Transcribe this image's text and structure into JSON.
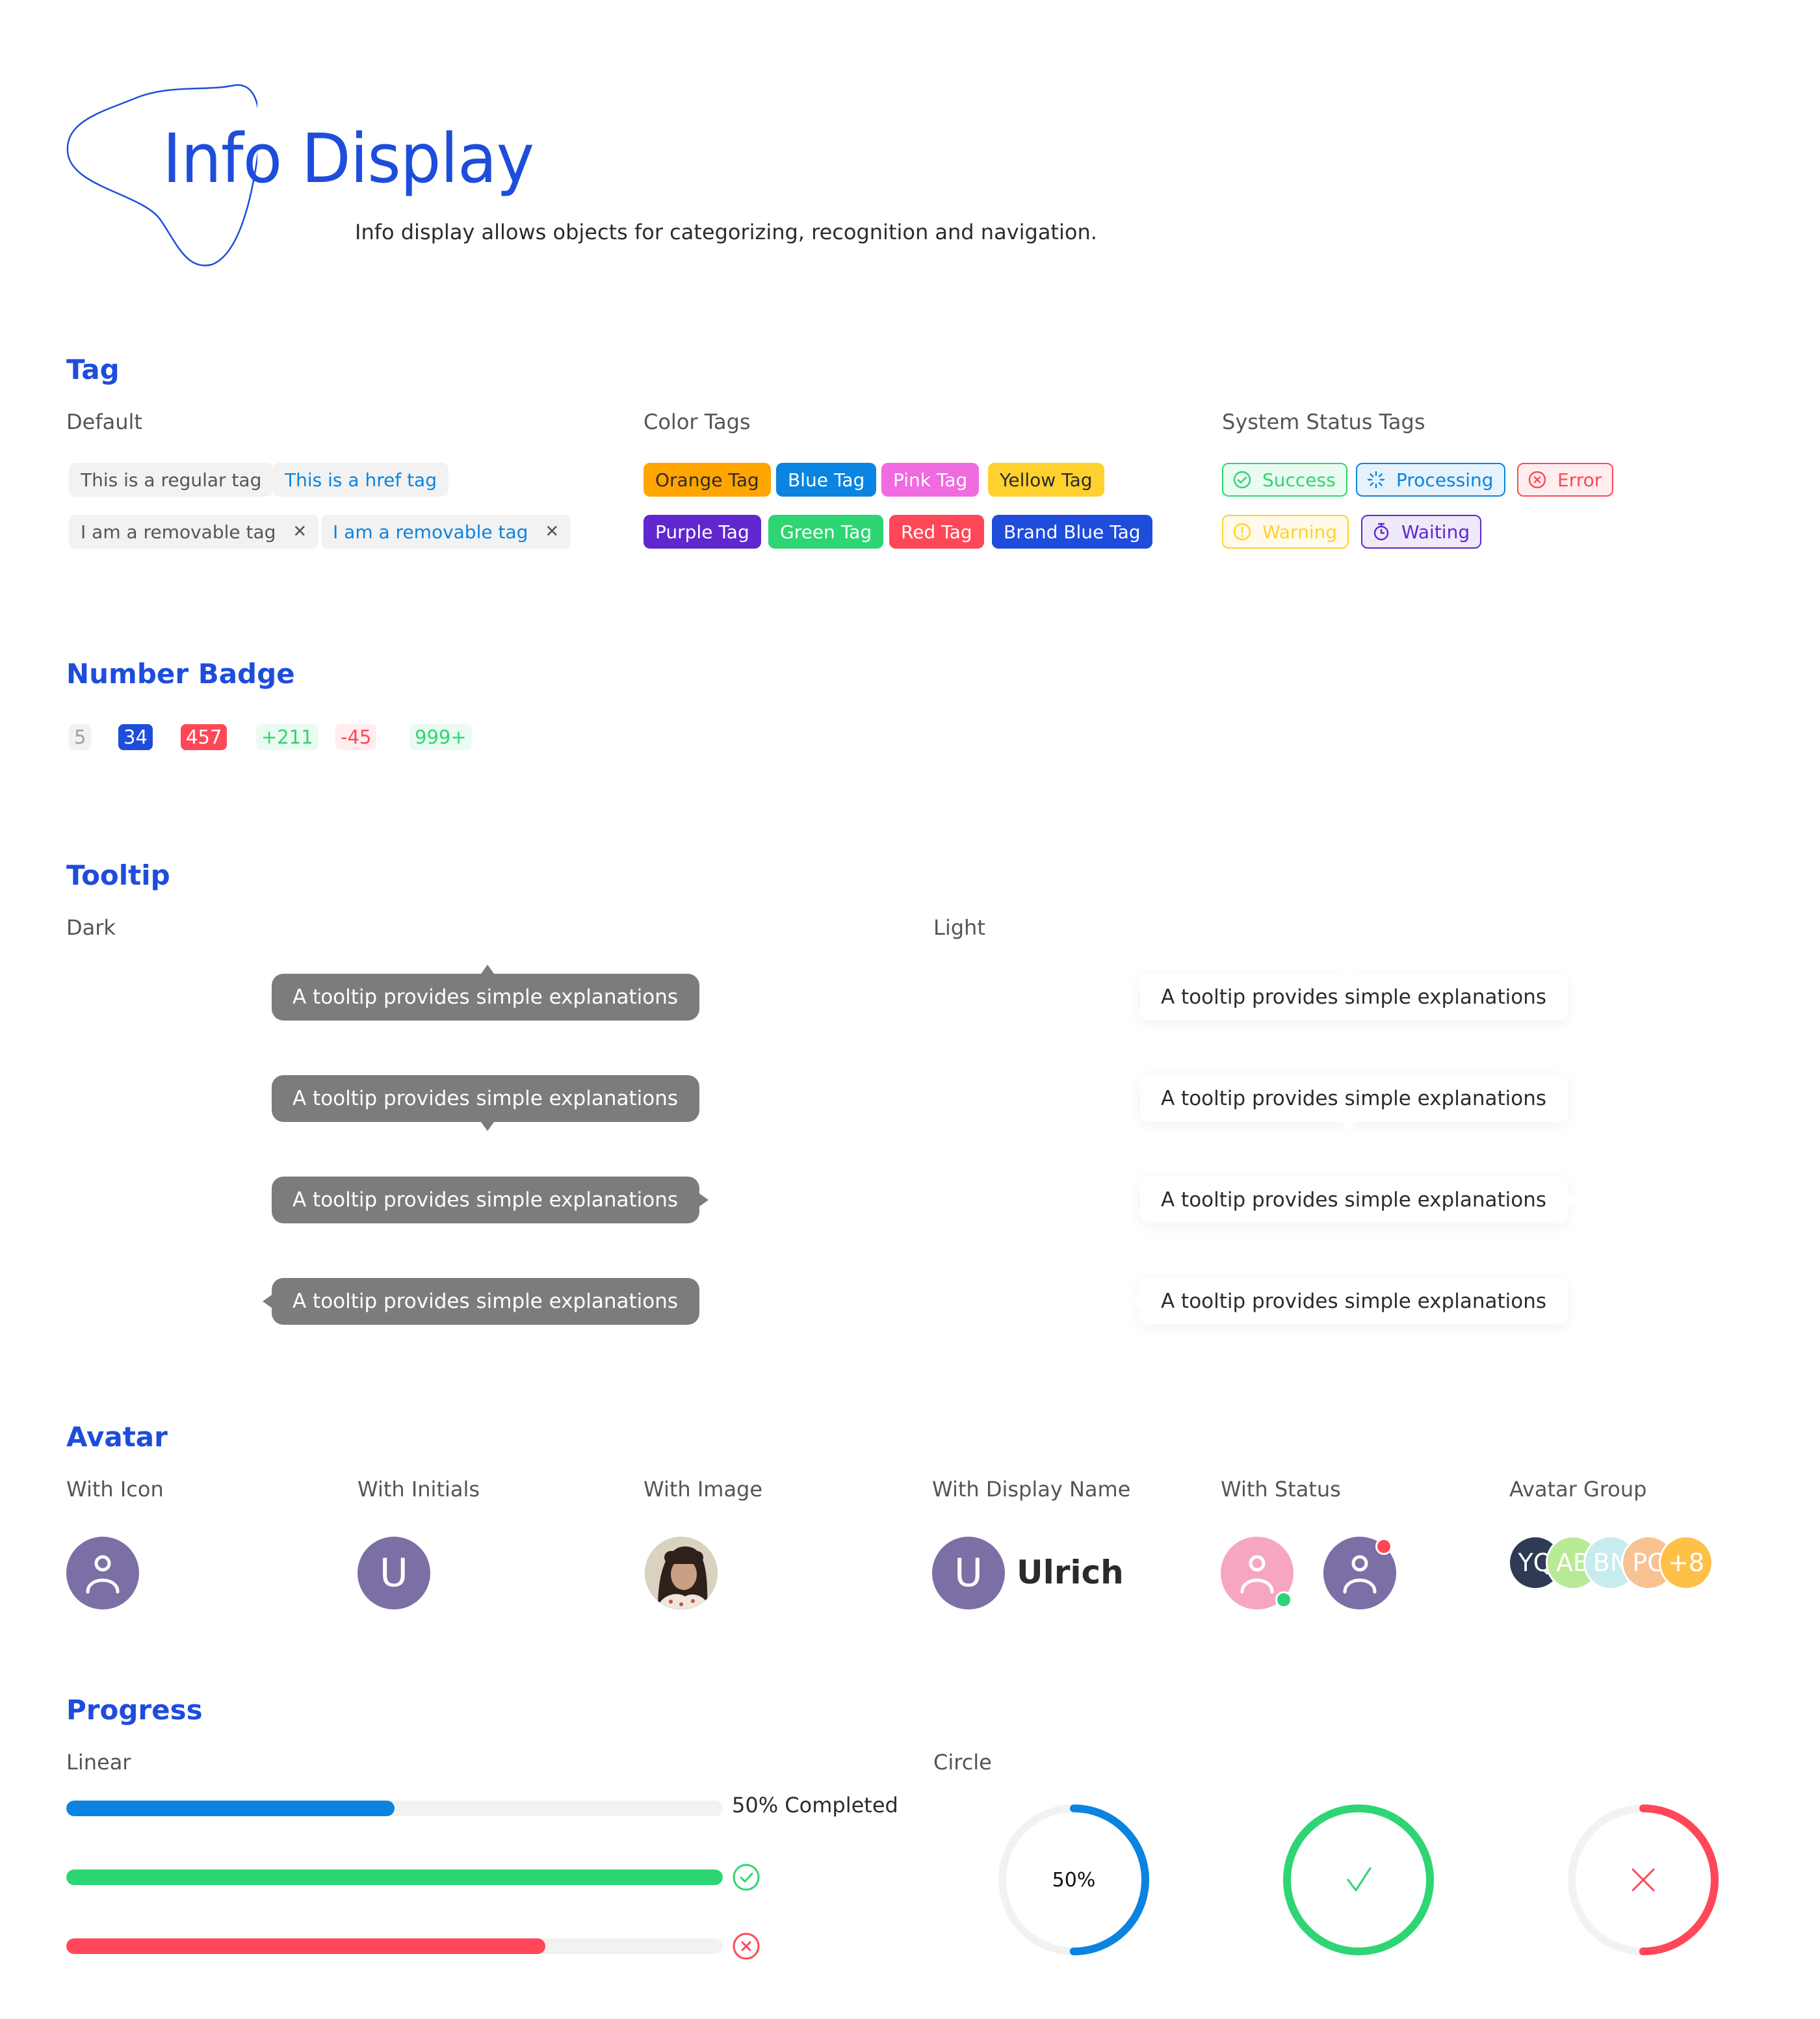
{
  "hero": {
    "title": "Info Display",
    "subtitle": "Info display allows objects for categorizing, recognition and navigation."
  },
  "colors": {
    "brand": "#1e4ddc",
    "orange": "#ffa500",
    "blue": "#0a84e0",
    "pink": "#f06ae0",
    "yellow": "#ffd12e",
    "purple": "#5f27cd",
    "green": "#2ed573",
    "red": "#ff4757",
    "brand_blue": "#1e4ddc",
    "avatar_purple": "#7b6fa6",
    "avatar_pink": "#f6a6c1"
  },
  "tag": {
    "title": "Tag",
    "default": {
      "label": "Default",
      "regular": "This is a regular tag",
      "href": "This is a href tag",
      "removable": "I am a removable tag",
      "removable_link": "I am a removable tag",
      "close_glyph": "✕"
    },
    "color": {
      "label": "Color Tags",
      "items": [
        {
          "label": "Orange Tag",
          "color": "#ffa500",
          "text": "#2b2b2b"
        },
        {
          "label": "Blue Tag",
          "color": "#0a84e0",
          "text": "#ffffff"
        },
        {
          "label": "Pink Tag",
          "color": "#f06ae0",
          "text": "#ffffff"
        },
        {
          "label": "Yellow Tag",
          "color": "#ffd12e",
          "text": "#2b2b2b"
        },
        {
          "label": "Purple Tag",
          "color": "#5f27cd",
          "text": "#ffffff"
        },
        {
          "label": "Green Tag",
          "color": "#2ed573",
          "text": "#ffffff"
        },
        {
          "label": "Red Tag",
          "color": "#ff4757",
          "text": "#ffffff"
        },
        {
          "label": "Brand Blue Tag",
          "color": "#1e4ddc",
          "text": "#ffffff"
        }
      ]
    },
    "status": {
      "label": "System Status Tags",
      "items": [
        {
          "label": "Success",
          "icon": "check-circle-icon",
          "color": "#2ed573",
          "bg": "#eafbf1"
        },
        {
          "label": "Processing",
          "icon": "spinner-icon",
          "color": "#0a84e0",
          "bg": "#e6f2fc"
        },
        {
          "label": "Error",
          "icon": "x-circle-icon",
          "color": "#ff4757",
          "bg": "#ffedef"
        },
        {
          "label": "Warning",
          "icon": "exclamation-circle-icon",
          "color": "#ffd12e",
          "bg": "#fffaea"
        },
        {
          "label": "Waiting",
          "icon": "stopwatch-icon",
          "color": "#5f27cd",
          "bg": "#efe9fa"
        }
      ]
    }
  },
  "badge": {
    "title": "Number Badge",
    "items": [
      {
        "value": "5",
        "bg": "#f2f2f2",
        "text": "#a0a0a0"
      },
      {
        "value": "34",
        "bg": "#1e4ddc",
        "text": "#ffffff"
      },
      {
        "value": "457",
        "bg": "#ff4757",
        "text": "#ffffff"
      },
      {
        "value": "+211",
        "bg": "#eafbf1",
        "text": "#2ed573"
      },
      {
        "value": "-45",
        "bg": "#ffedef",
        "text": "#ff4757"
      },
      {
        "value": "999+",
        "bg": "#eafbf1",
        "text": "#2ed573"
      }
    ]
  },
  "tooltip": {
    "title": "Tooltip",
    "dark_label": "Dark",
    "light_label": "Light",
    "text": "A tooltip provides simple explanations",
    "placements": [
      "up",
      "down",
      "right",
      "left"
    ]
  },
  "avatar": {
    "title": "Avatar",
    "with_icon": "With Icon",
    "with_initials": "With Initials",
    "with_image": "With Image",
    "with_display_name": "With Display Name",
    "with_status": "With Status",
    "avatar_group": "Avatar Group",
    "initial": "U",
    "display_initial": "U",
    "display_name": "Ulrich",
    "status_online": "online",
    "status_notification": "notification",
    "group": [
      {
        "initials": "YQ",
        "color": "#2f3a55"
      },
      {
        "initials": "AB",
        "color": "#b8e994"
      },
      {
        "initials": "BN",
        "color": "#c7ecee"
      },
      {
        "initials": "PC",
        "color": "#f8c291"
      },
      {
        "initials": "+8",
        "color": "#ffc048"
      }
    ]
  },
  "progress": {
    "title": "Progress",
    "linear_label": "Linear",
    "circle_label": "Circle",
    "linear": [
      {
        "percent": 50,
        "status": "active",
        "label": "50% Completed",
        "color": "#0a84e0"
      },
      {
        "percent": 100,
        "status": "success",
        "color": "#2ed573"
      },
      {
        "percent": 73,
        "status": "error",
        "color": "#ff4757"
      }
    ],
    "circle": [
      {
        "percent": 50,
        "status": "active",
        "label": "50%",
        "color": "#0a84e0"
      },
      {
        "percent": 100,
        "status": "success",
        "color": "#2ed573"
      },
      {
        "percent": 50,
        "status": "error",
        "color": "#ff4757"
      }
    ]
  }
}
